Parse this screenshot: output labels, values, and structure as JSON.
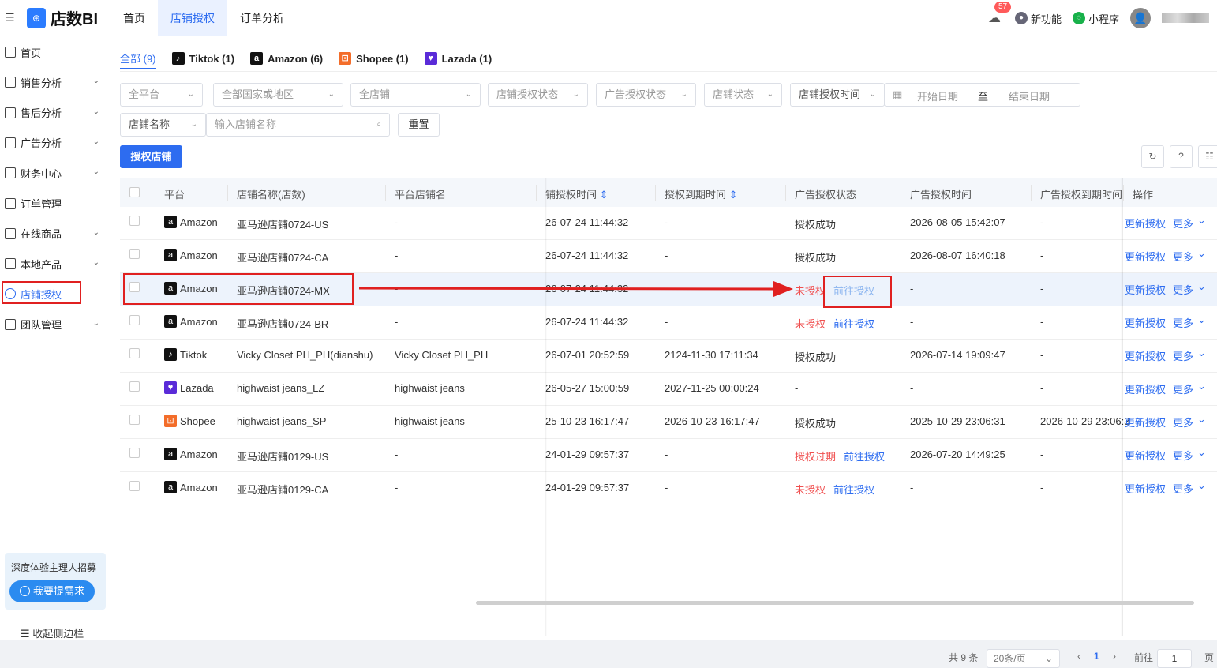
{
  "app": {
    "name": "店数BI",
    "logo_glyph": "⊕"
  },
  "topnav": {
    "items": [
      "首页",
      "店铺授权",
      "订单分析"
    ],
    "active_index": 1
  },
  "topright": {
    "notif_count": "57",
    "new_features": "新功能",
    "mini_program": "小程序"
  },
  "sidebar": {
    "items": [
      {
        "label": "首页",
        "expandable": false
      },
      {
        "label": "销售分析",
        "expandable": true
      },
      {
        "label": "售后分析",
        "expandable": true
      },
      {
        "label": "广告分析",
        "expandable": true
      },
      {
        "label": "财务中心",
        "expandable": true
      },
      {
        "label": "订单管理",
        "expandable": false
      },
      {
        "label": "在线商品",
        "expandable": true
      },
      {
        "label": "本地产品",
        "expandable": true
      },
      {
        "label": "店铺授权",
        "expandable": false,
        "active": true
      },
      {
        "label": "团队管理",
        "expandable": true
      }
    ],
    "promo_text": "深度体验主理人招募",
    "promo_button": "我要提需求",
    "collapse_label": "收起侧边栏"
  },
  "tabs": [
    {
      "label": "全部 (9)",
      "active": true
    },
    {
      "label": "Tiktok (1)",
      "icon": "tiktok-icon"
    },
    {
      "label": "Amazon (6)",
      "icon": "amazon-icon"
    },
    {
      "label": "Shopee (1)",
      "icon": "shopee-icon"
    },
    {
      "label": "Lazada (1)",
      "icon": "lazada-icon"
    }
  ],
  "filters": {
    "platform": "全平台",
    "country": "全部国家或地区",
    "store": "全店铺",
    "store_auth_status": "店铺授权状态",
    "ad_auth_status": "广告授权状态",
    "store_status": "店铺状态",
    "time_type": "店铺授权时间",
    "start_date": "开始日期",
    "date_sep": "至",
    "end_date": "结束日期",
    "search_type": "店铺名称",
    "search_placeholder": "输入店铺名称",
    "reset": "重置"
  },
  "auth_button": "授权店铺",
  "table": {
    "headers": [
      "平台",
      "店铺名称(店数)",
      "平台店铺名",
      "铺授权时间",
      "授权到期时间",
      "广告授权状态",
      "广告授权时间",
      "广告授权到期时间",
      "操作"
    ],
    "rows": [
      {
        "platform": "Amazon",
        "name": "亚马逊店铺0724-US",
        "shop": "-",
        "auth_time": "26-07-24 11:44:32",
        "expire": "-",
        "ad_status": "授权成功",
        "ad_status_type": "ok",
        "ad_link": "",
        "ad_time": "2026-08-05 15:42:07",
        "ad_expire": "-"
      },
      {
        "platform": "Amazon",
        "name": "亚马逊店铺0724-CA",
        "shop": "-",
        "auth_time": "26-07-24 11:44:32",
        "expire": "-",
        "ad_status": "授权成功",
        "ad_status_type": "ok",
        "ad_link": "",
        "ad_time": "2026-08-07 16:40:18",
        "ad_expire": "-"
      },
      {
        "platform": "Amazon",
        "name": "亚马逊店铺0724-MX",
        "shop": "-",
        "auth_time": "26-07-24 11:44:32",
        "expire": "",
        "ad_status": "未授权",
        "ad_status_type": "bad",
        "ad_link": "前往授权",
        "ad_time": "-",
        "ad_expire": "-"
      },
      {
        "platform": "Amazon",
        "name": "亚马逊店铺0724-BR",
        "shop": "-",
        "auth_time": "26-07-24 11:44:32",
        "expire": "-",
        "ad_status": "未授权",
        "ad_status_type": "bad",
        "ad_link": "前往授权",
        "ad_time": "-",
        "ad_expire": "-"
      },
      {
        "platform": "Tiktok",
        "name": "Vicky Closet PH_PH(dianshu)",
        "shop": "Vicky Closet PH_PH",
        "auth_time": "26-07-01 20:52:59",
        "expire": "2124-11-30 17:11:34",
        "ad_status": "授权成功",
        "ad_status_type": "ok",
        "ad_link": "",
        "ad_time": "2026-07-14 19:09:47",
        "ad_expire": "-"
      },
      {
        "platform": "Lazada",
        "name": "highwaist jeans_LZ",
        "shop": "highwaist jeans",
        "auth_time": "26-05-27 15:00:59",
        "expire": "2027-11-25 00:00:24",
        "ad_status": "-",
        "ad_status_type": "ok",
        "ad_link": "",
        "ad_time": "-",
        "ad_expire": "-"
      },
      {
        "platform": "Shopee",
        "name": "highwaist jeans_SP",
        "shop": "highwaist jeans",
        "auth_time": "25-10-23 16:17:47",
        "expire": "2026-10-23 16:17:47",
        "ad_status": "授权成功",
        "ad_status_type": "ok",
        "ad_link": "",
        "ad_time": "2025-10-29 23:06:31",
        "ad_expire": "2026-10-29 23:06:3"
      },
      {
        "platform": "Amazon",
        "name": "亚马逊店铺0129-US",
        "shop": "-",
        "auth_time": "24-01-29 09:57:37",
        "expire": "-",
        "ad_status": "授权过期",
        "ad_status_type": "bad",
        "ad_link": "前往授权",
        "ad_time": "2026-07-20 14:49:25",
        "ad_expire": "-"
      },
      {
        "platform": "Amazon",
        "name": "亚马逊店铺0129-CA",
        "shop": "-",
        "auth_time": "24-01-29 09:57:37",
        "expire": "-",
        "ad_status": "未授权",
        "ad_status_type": "bad",
        "ad_link": "前往授权",
        "ad_time": "-",
        "ad_expire": "-"
      }
    ],
    "action_update": "更新授权",
    "action_more": "更多"
  },
  "pagination": {
    "total": "共 9 条",
    "page_size": "20条/页",
    "current_page": "1",
    "goto_label": "前往",
    "goto_value": "1",
    "page_suffix": "页"
  },
  "colors": {
    "primary": "#2d6cf0",
    "danger": "#f05050",
    "annotation": "#e02020"
  }
}
